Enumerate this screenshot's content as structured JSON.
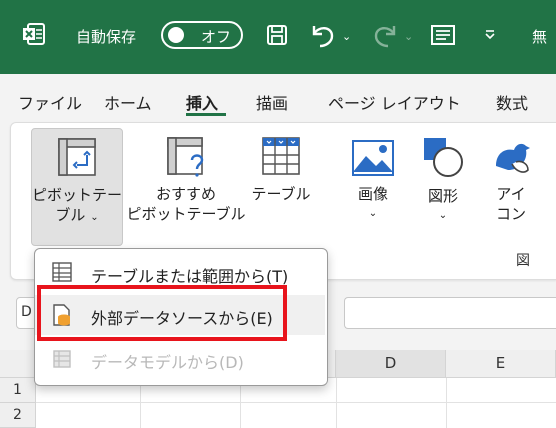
{
  "titlebar": {
    "autosave_label": "自動保存",
    "toggle_state": "オフ",
    "document_title": "無",
    "icons": [
      "excel-logo-icon",
      "save-icon",
      "undo-icon",
      "redo-icon",
      "form-icon",
      "customize-qat-icon"
    ]
  },
  "tabs": [
    {
      "label": "ファイル",
      "active": false
    },
    {
      "label": "ホーム",
      "active": false
    },
    {
      "label": "挿入",
      "active": true
    },
    {
      "label": "描画",
      "active": false
    },
    {
      "label": "ページ レイアウト",
      "active": false
    },
    {
      "label": "数式",
      "active": false
    }
  ],
  "ribbon": {
    "pivottable": {
      "line1": "ピボットテー",
      "line2": "ブル",
      "chevron": "⌄"
    },
    "recommended_pivot": {
      "line1": "おすすめ",
      "line2": "ピボットテーブル"
    },
    "table": {
      "line1": "テーブル"
    },
    "pictures": {
      "line1": "画像",
      "chevron": "⌄"
    },
    "shapes": {
      "line1": "図形",
      "chevron": "⌄"
    },
    "icons": {
      "line1": "アイ",
      "line2": "コン"
    },
    "group_label": "図"
  },
  "namebox_fragment": "D",
  "columns": [
    "D",
    "E"
  ],
  "rows": [
    "1",
    "2"
  ],
  "menu": {
    "items": [
      {
        "label": "テーブルまたは範囲から(T)",
        "enabled": true
      },
      {
        "label": "外部データソースから(E)",
        "enabled": true,
        "highlighted": true
      },
      {
        "label": "データモデルから(D)",
        "enabled": false
      }
    ]
  },
  "colors": {
    "excel_green": "#217346",
    "highlight_red": "#e8141c",
    "accent_blue": "#2b6cc4"
  }
}
